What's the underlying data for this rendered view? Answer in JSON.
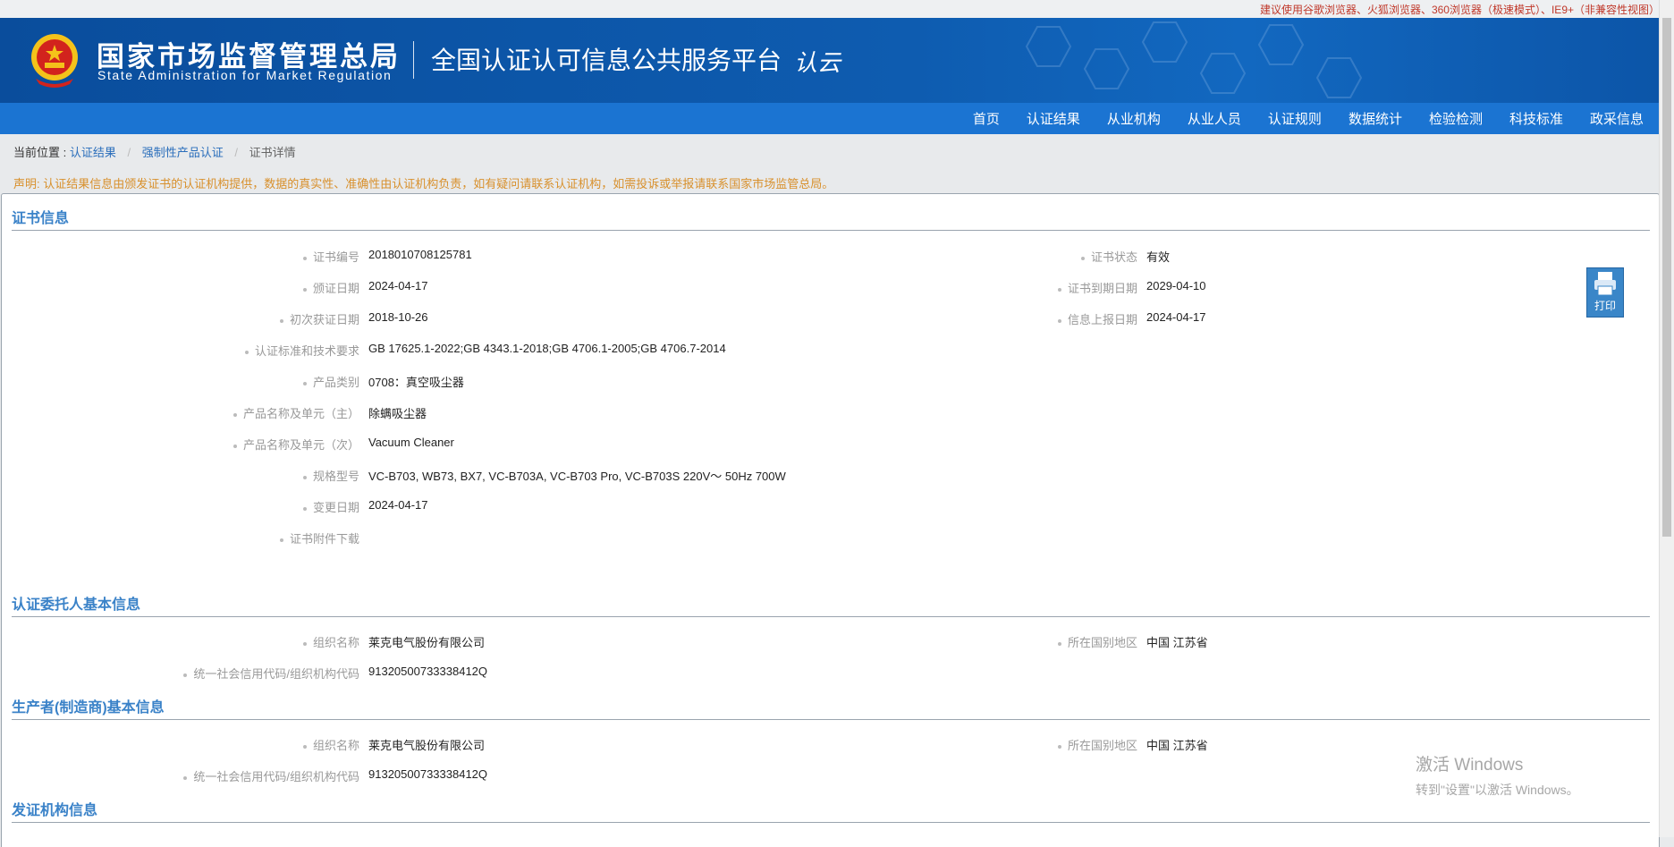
{
  "topbar": {
    "browser_tip": "建议使用谷歌浏览器、火狐浏览器、360浏览器（极速模式）、IE9+（非兼容性视图）"
  },
  "header": {
    "org_name_cn": "国家市场监督管理总局",
    "org_name_en": "State Administration  for  Market Regulation",
    "platform_title": "全国认证认可信息公共服务平台",
    "logo_text": "认云"
  },
  "nav": [
    "首页",
    "认证结果",
    "从业机构",
    "从业人员",
    "认证规则",
    "数据统计",
    "检验检测",
    "科技标准",
    "政采信息"
  ],
  "breadcrumb": {
    "prefix": "当前位置 :",
    "items": [
      "认证结果",
      "强制性产品认证",
      "证书详情"
    ]
  },
  "notice": "声明: 认证结果信息由颁发证书的认证机构提供，数据的真实性、准确性由认证机构负责，如有疑问请联系认证机构，如需投诉或举报请联系国家市场监管总局。",
  "cert_info": {
    "title": "证书信息",
    "left": [
      {
        "label": "证书编号",
        "value": "2018010708125781"
      },
      {
        "label": "颁证日期",
        "value": "2024-04-17"
      },
      {
        "label": "初次获证日期",
        "value": "2018-10-26"
      },
      {
        "label": "认证标准和技术要求",
        "value": "GB 17625.1-2022;GB 4343.1-2018;GB 4706.1-2005;GB 4706.7-2014"
      },
      {
        "label": "产品类别",
        "value": "0708：真空吸尘器"
      },
      {
        "label": "产品名称及单元（主）",
        "value": "除螨吸尘器"
      },
      {
        "label": "产品名称及单元（次）",
        "value": "Vacuum Cleaner"
      },
      {
        "label": "规格型号",
        "value": "VC-B703, WB73, BX7, VC-B703A, VC-B703 Pro, VC-B703S 220V～ 50Hz 700W"
      },
      {
        "label": "变更日期",
        "value": "2024-04-17"
      },
      {
        "label": "证书附件下载",
        "value": ""
      }
    ],
    "right": [
      {
        "label": "证书状态",
        "value": "有效"
      },
      {
        "label": "证书到期日期",
        "value": "2029-04-10"
      },
      {
        "label": "信息上报日期",
        "value": "2024-04-17"
      }
    ]
  },
  "client_info": {
    "title": "认证委托人基本信息",
    "org_label": "组织名称",
    "org_value": "莱克电气股份有限公司",
    "region_label": "所在国别地区",
    "region_value": "中国 江苏省",
    "code_label": "统一社会信用代码/组织机构代码",
    "code_value": "91320500733338412Q"
  },
  "producer_info": {
    "title": "生产者(制造商)基本信息",
    "org_label": "组织名称",
    "org_value": "莱克电气股份有限公司",
    "region_label": "所在国别地区",
    "region_value": "中国 江苏省",
    "code_label": "统一社会信用代码/组织机构代码",
    "code_value": "91320500733338412Q"
  },
  "issuer_info": {
    "title": "发证机构信息"
  },
  "print_button": {
    "label": "打印",
    "icon": "printer-icon"
  },
  "watermark": {
    "line1": "激活 Windows",
    "line2": "转到\"设置\"以激活 Windows。"
  },
  "colors": {
    "header_blue": "#0e5cb0",
    "nav_blue": "#1b74d2",
    "section_title": "#3a82c8",
    "notice": "#d8902c",
    "tip_red": "#c0392b"
  }
}
